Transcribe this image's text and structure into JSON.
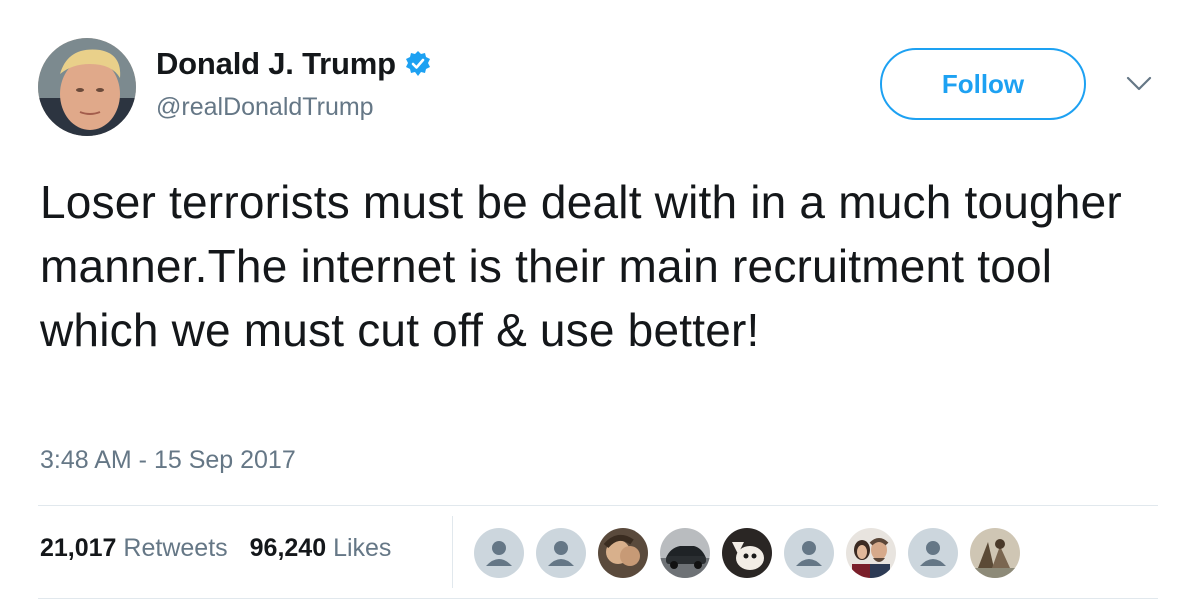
{
  "author": {
    "name": "Donald J. Trump",
    "handle": "@realDonaldTrump",
    "verified": true
  },
  "follow_button": {
    "label": "Follow"
  },
  "tweet": {
    "text": "Loser terrorists must be dealt with in a much tougher manner.The internet is their main recruitment tool which we must cut off & use better!",
    "timestamp": "3:48 AM - 15 Sep 2017"
  },
  "stats": {
    "retweets_count": "21,017",
    "retweets_label": "Retweets",
    "likes_count": "96,240",
    "likes_label": "Likes"
  },
  "likers": [
    "default-avatar",
    "default-avatar",
    "photo-avatar",
    "photo-avatar",
    "photo-avatar",
    "default-avatar",
    "photo-avatar",
    "default-avatar",
    "photo-avatar"
  ],
  "colors": {
    "accent": "#1da1f2",
    "text": "#14171a",
    "secondary": "#657786",
    "divider": "#e1e8ed"
  }
}
